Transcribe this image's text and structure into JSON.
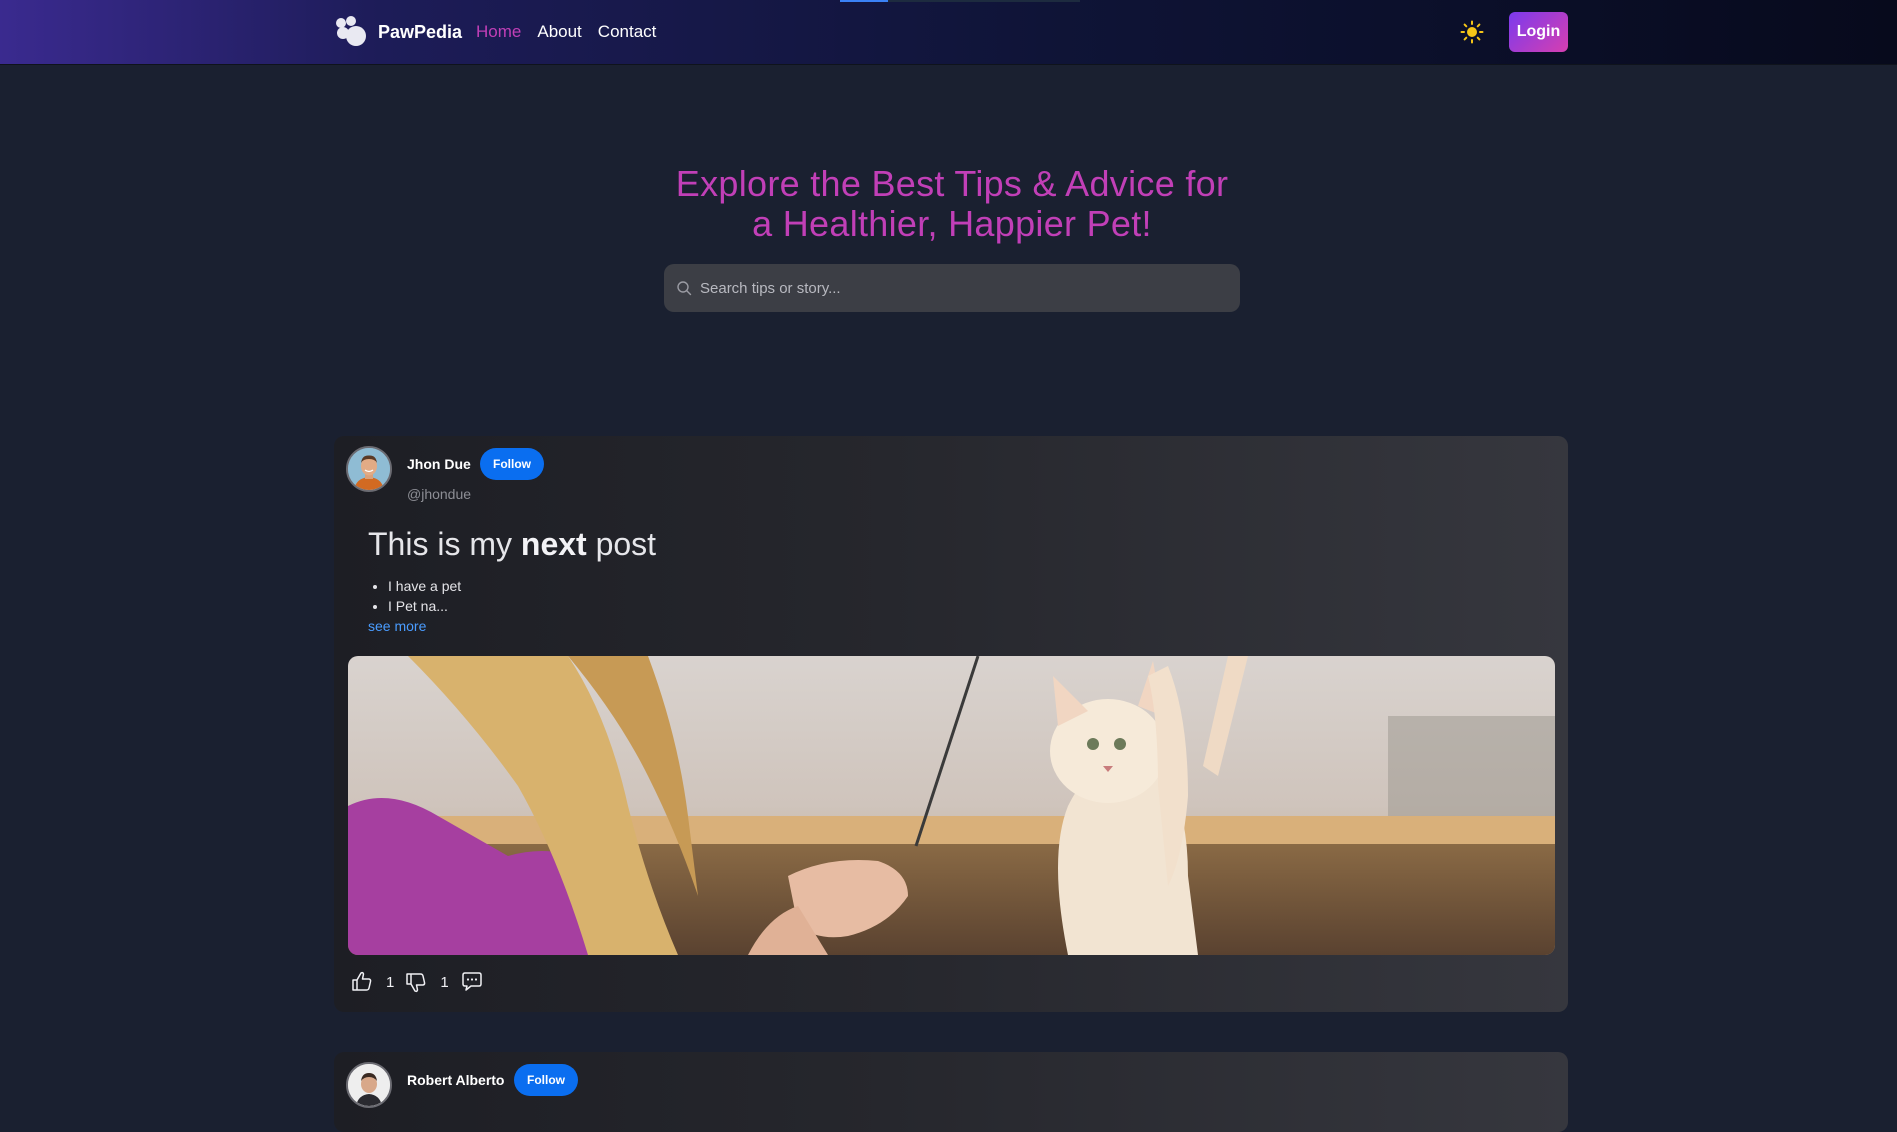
{
  "app": {
    "name": "PawPedia"
  },
  "nav": {
    "links": [
      {
        "label": "Home",
        "active": true
      },
      {
        "label": "About",
        "active": false
      },
      {
        "label": "Contact",
        "active": false
      }
    ],
    "login_label": "Login",
    "theme_icon": "sun-icon"
  },
  "hero": {
    "title_line1": "Explore the Best Tips & Advice for",
    "title_line2": "a Healthier, Happier Pet!",
    "search_placeholder": "Search tips or story..."
  },
  "colors": {
    "accent": "#c13fb7",
    "follow": "#0a6ef0",
    "link": "#4a9cff",
    "login_gradient": [
      "#7b3aed",
      "#d63fb0"
    ]
  },
  "posts": [
    {
      "author": "Jhon Due",
      "handle": "@jhondue",
      "follow_label": "Follow",
      "title_parts": [
        "This is my ",
        "next",
        " post"
      ],
      "bullets": [
        "I have a pet",
        "I Pet na..."
      ],
      "see_more": "see more",
      "likes": "1",
      "dislikes": "1"
    },
    {
      "author": "Robert Alberto",
      "follow_label": "Follow"
    }
  ]
}
